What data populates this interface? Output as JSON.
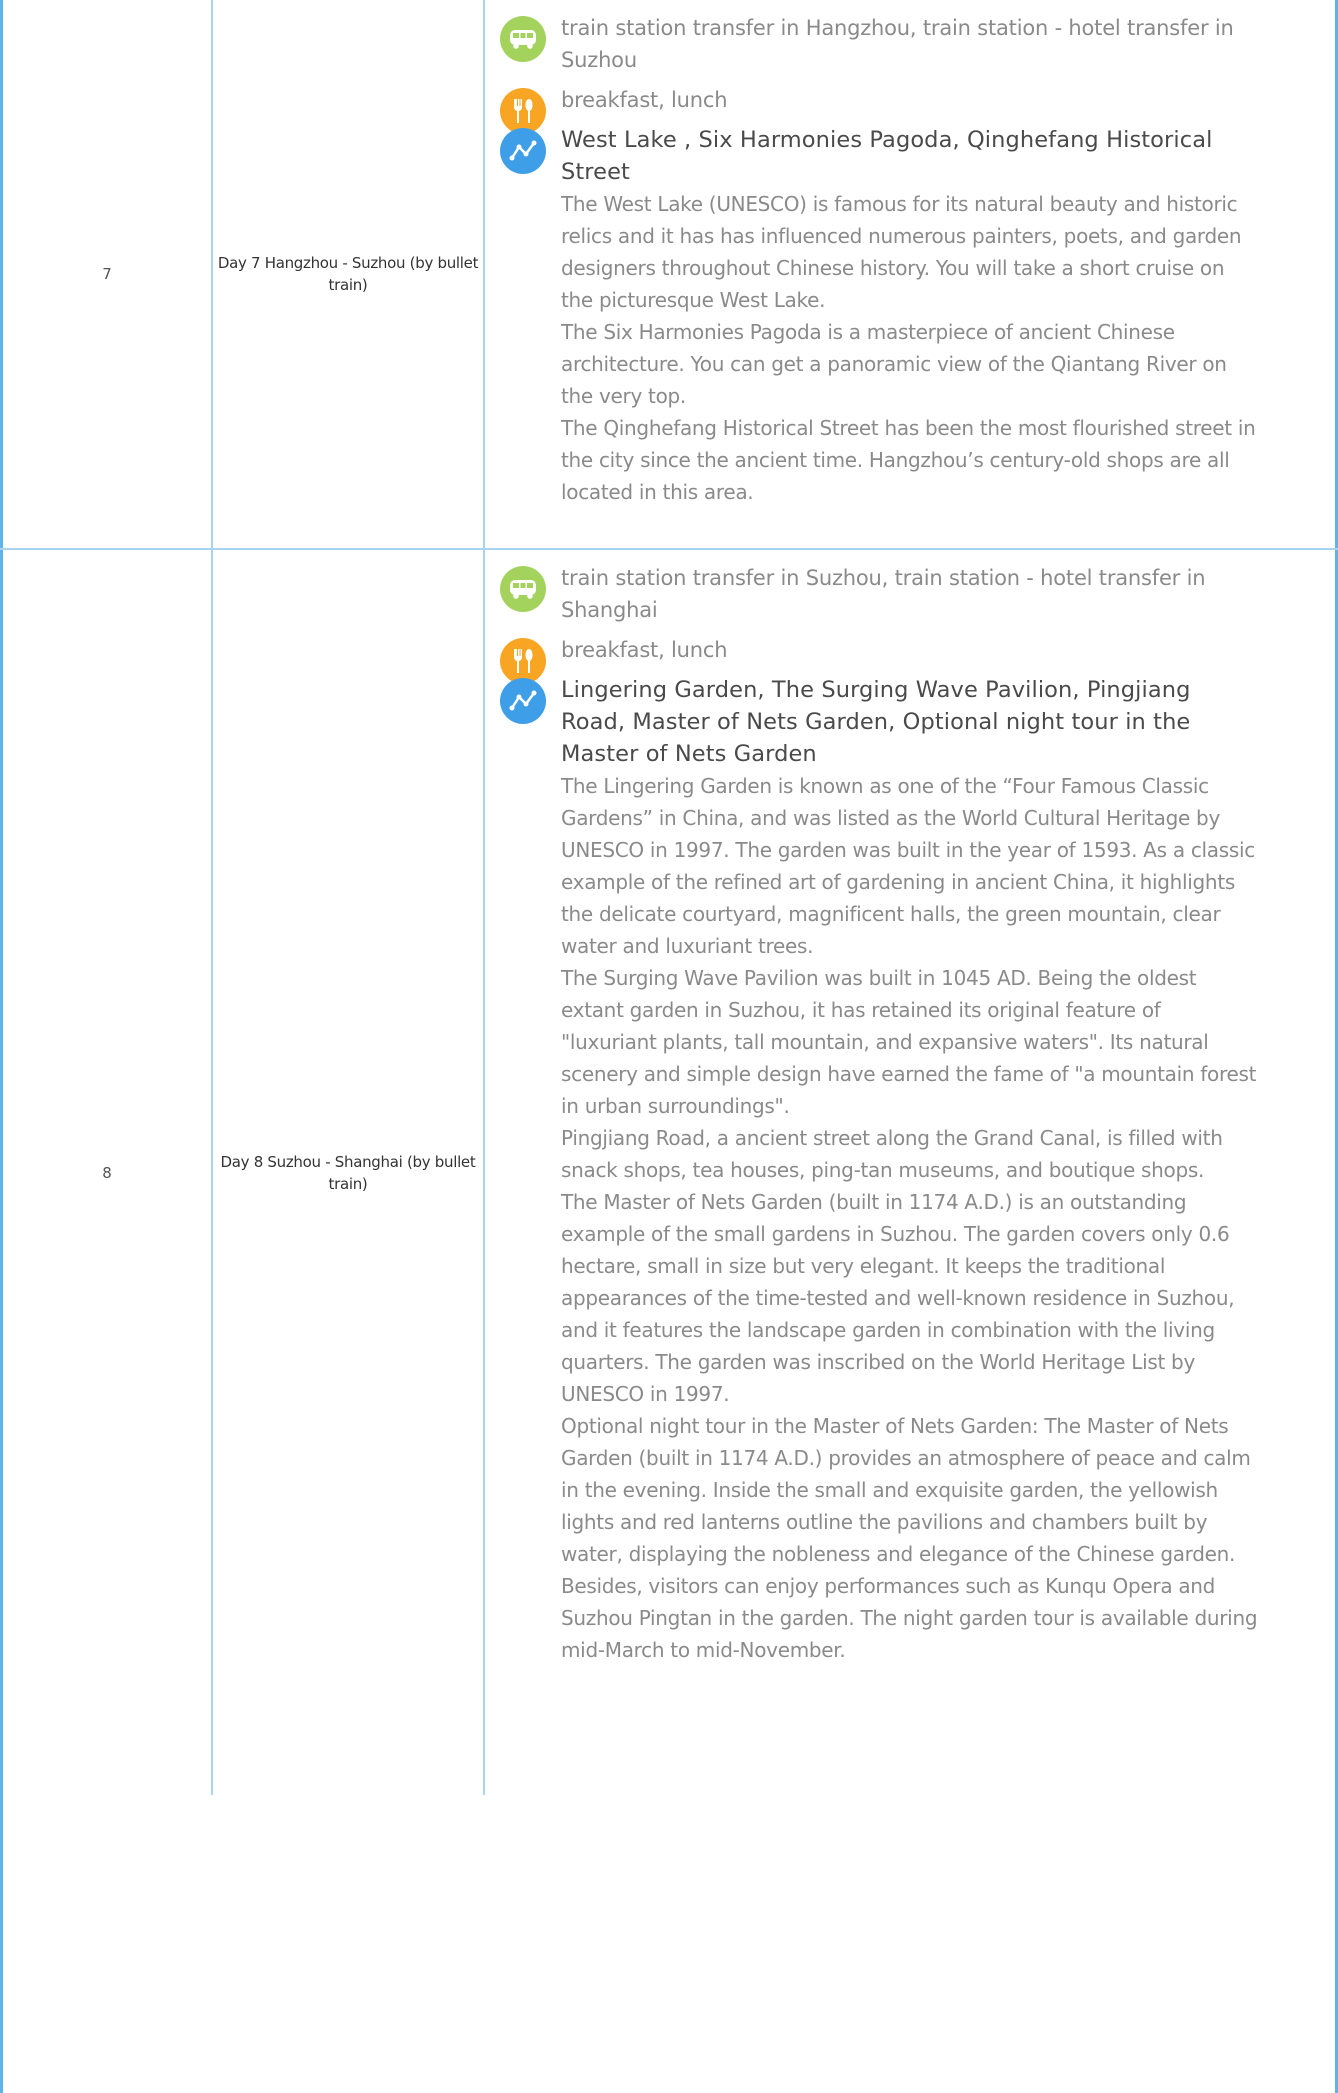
{
  "rows": [
    {
      "num": "7",
      "day": "Day 7 Hangzhou - Suzhou (by bullet train)",
      "transfer": "train station transfer in Hangzhou, train station - hotel transfer in Suzhou",
      "meals": "breakfast, lunch",
      "sights_title": "West Lake , Six Harmonies Pagoda, Qinghefang Historical Street",
      "paragraphs": [
        "The West Lake (UNESCO) is famous for its natural beauty and historic relics and it has has influenced numerous painters, poets, and garden designers throughout Chinese history. You will take a short cruise on the picturesque West Lake.",
        "The Six Harmonies Pagoda is a masterpiece of ancient Chinese architecture. You can get a panoramic view of the Qiantang River on the very top.",
        "The Qinghefang Historical Street has been the most flourished street in the city since the ancient time. Hangzhou’s century-old shops are all located in this area."
      ]
    },
    {
      "num": "8",
      "day": "Day 8 Suzhou - Shanghai (by bullet train)",
      "transfer": "train station transfer in Suzhou, train station - hotel transfer in Shanghai",
      "meals": "breakfast, lunch",
      "sights_title": "Lingering Garden, The Surging Wave Pavilion, Pingjiang Road, Master of Nets Garden, Optional night tour in the Master of Nets Garden",
      "paragraphs": [
        "The Lingering Garden is known as one of the “Four Famous Classic Gardens” in China, and was listed as the World Cultural Heritage by UNESCO in 1997. The garden was built in the year of 1593. As a classic example of the refined art of gardening in ancient China, it highlights the delicate courtyard, magnificent halls, the green mountain, clear water and luxuriant trees.",
        "The Surging Wave Pavilion was built in 1045 AD. Being the oldest extant garden in Suzhou, it has retained its original feature of \"luxuriant plants, tall mountain, and expansive waters\". Its natural scenery and simple design have earned the fame of \"a mountain forest in urban surroundings\".",
        "Pingjiang Road, a ancient street along the Grand Canal, is filled with snack shops, tea houses, ping-tan museums, and boutique shops.",
        "The Master of Nets Garden (built in 1174 A.D.) is an outstanding example of the small gardens in Suzhou. The garden covers only 0.6 hectare, small in size but very elegant. It keeps the traditional appearances of the time-tested and well-known residence in Suzhou, and it features the landscape garden in combination with the living quarters. The garden was inscribed on the World Heritage List by UNESCO in 1997.",
        "Optional night tour in the Master of Nets Garden: The Master of Nets Garden (built in 1174 A.D.) provides an atmosphere of peace and calm in the evening. Inside the small and exquisite garden, the yellowish lights and red lanterns outline the pavilions and chambers built by water, displaying the nobleness and elegance of the Chinese garden. Besides, visitors can enjoy performances such as Kunqu Opera and Suzhou Pingtan in the garden. The night garden tour is available during mid-March to mid-November."
      ]
    }
  ],
  "icons": {
    "transfer": "bus-icon",
    "meals": "fork-spoon-icon",
    "sights": "route-icon"
  },
  "colors": {
    "frame": "#5db3ea",
    "grid": "#a9d4f0",
    "bus_icon": "#a3d35c",
    "food_icon": "#f7a522",
    "route_icon": "#3f9ee8"
  }
}
